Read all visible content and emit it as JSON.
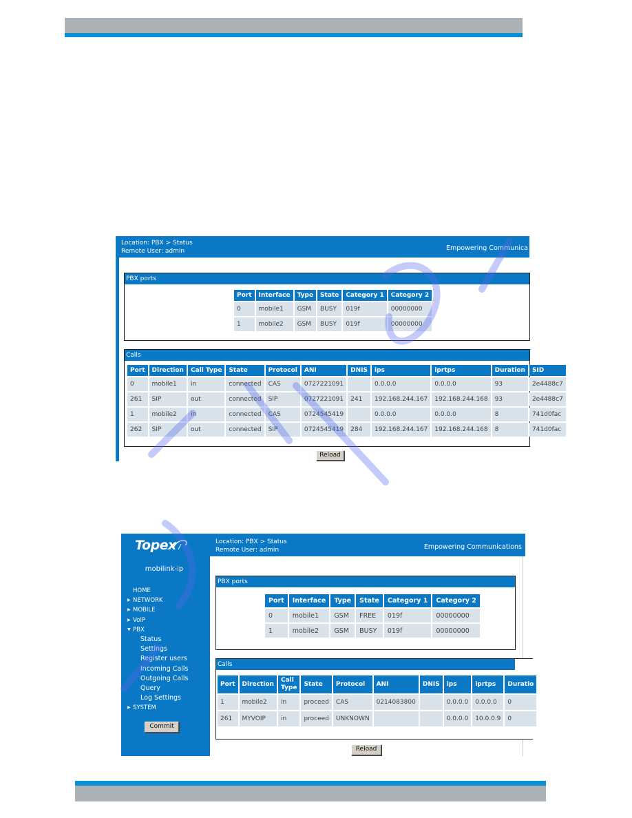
{
  "screenshot1": {
    "location": "Location: PBX > Status",
    "remote_user": "Remote User: admin",
    "tagline": "Empowering Communica",
    "pbx_ports": {
      "title": "PBX ports",
      "headers": [
        "Port",
        "Interface",
        "Type",
        "State",
        "Category 1",
        "Category 2"
      ],
      "rows": [
        [
          "0",
          "mobile1",
          "GSM",
          "BUSY",
          "019f",
          "00000000"
        ],
        [
          "1",
          "mobile2",
          "GSM",
          "BUSY",
          "019f",
          "00000000"
        ]
      ]
    },
    "calls": {
      "title": "Calls",
      "headers": [
        "Port",
        "Direction",
        "Call Type",
        "State",
        "Protocol",
        "ANI",
        "DNIS",
        "ips",
        "iprtps",
        "Duration",
        "SID"
      ],
      "rows": [
        [
          "0",
          "mobile1",
          "in",
          "connected",
          "CAS",
          "0727221091",
          "",
          "0.0.0.0",
          "0.0.0.0",
          "93",
          "2e4488c7"
        ],
        [
          "261",
          "SIP",
          "out",
          "connected",
          "SIP",
          "0727221091",
          "241",
          "192.168.244.167",
          "192.168.244.168",
          "93",
          "2e4488c7"
        ],
        [
          "1",
          "mobile2",
          "in",
          "connected",
          "CAS",
          "0724545419",
          "",
          "0.0.0.0",
          "0.0.0.0",
          "8",
          "741d0fac"
        ],
        [
          "262",
          "SIP",
          "out",
          "connected",
          "SIP",
          "0724545419",
          "284",
          "192.168.244.167",
          "192.168.244.168",
          "8",
          "741d0fac"
        ]
      ]
    },
    "reload_label": "Reload"
  },
  "screenshot2": {
    "logo": "Topex",
    "device_name": "mobilink-ip",
    "nav": [
      {
        "label": "HOME",
        "level": 0,
        "arrow": ""
      },
      {
        "label": "NETWORK",
        "level": 0,
        "arrow": "right"
      },
      {
        "label": "MOBILE",
        "level": 0,
        "arrow": "right"
      },
      {
        "label": "VoIP",
        "level": 0,
        "arrow": "right"
      },
      {
        "label": "PBX",
        "level": 0,
        "arrow": "down"
      },
      {
        "label": "Status",
        "level": 1,
        "arrow": ""
      },
      {
        "label": "Settings",
        "level": 1,
        "arrow": ""
      },
      {
        "label": "Register users",
        "level": 1,
        "arrow": ""
      },
      {
        "label": "Incoming Calls",
        "level": 1,
        "arrow": ""
      },
      {
        "label": "Outgoing Calls",
        "level": 1,
        "arrow": ""
      },
      {
        "label": "Query",
        "level": 1,
        "arrow": ""
      },
      {
        "label": "Log Settings",
        "level": 1,
        "arrow": ""
      },
      {
        "label": "SYSTEM",
        "level": 0,
        "arrow": "right"
      }
    ],
    "commit_label": "Commit",
    "location": "Location: PBX > Status",
    "remote_user": "Remote User: admin",
    "tagline": "Empowering Communications",
    "pbx_ports": {
      "title": "PBX ports",
      "headers": [
        "Port",
        "Interface",
        "Type",
        "State",
        "Category 1",
        "Category 2"
      ],
      "rows": [
        [
          "0",
          "mobile1",
          "GSM",
          "FREE",
          "019f",
          "00000000"
        ],
        [
          "1",
          "mobile2",
          "GSM",
          "BUSY",
          "019f",
          "00000000"
        ]
      ]
    },
    "calls": {
      "title": "Calls",
      "headers": [
        "Port",
        "Direction",
        "Call Type",
        "State",
        "Protocol",
        "ANI",
        "DNIS",
        "ips",
        "iprtps",
        "Duratio"
      ],
      "rows": [
        [
          "1",
          "mobile2",
          "in",
          "proceed",
          "CAS",
          "0214083800",
          "",
          "0.0.0.0",
          "0.0.0.0",
          "0"
        ],
        [
          "261",
          "MYVOIP",
          "in",
          "proceed",
          "UNKNOWN",
          "",
          "",
          "0.0.0.0",
          "10.0.0.9",
          "0"
        ]
      ]
    },
    "reload_label": "Reload"
  },
  "colors": {
    "header_blue": "#0a78c4",
    "band_blue": "#0a8ed6",
    "band_gray": "#acb1b5",
    "cell_bg": "#d8e2ea"
  }
}
